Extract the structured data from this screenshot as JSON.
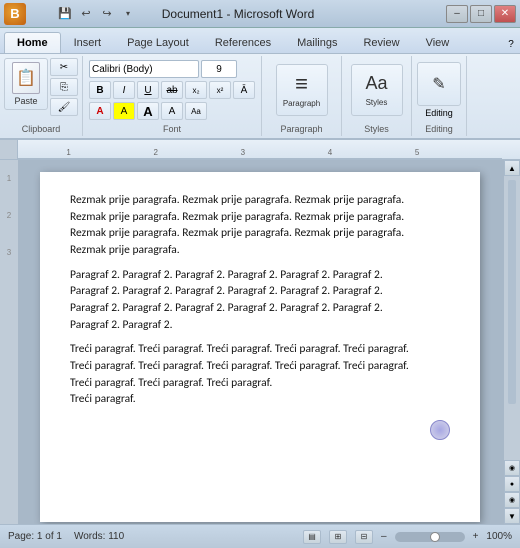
{
  "titlebar": {
    "title": "Document1 - Microsoft Word",
    "app_label": "W",
    "min_label": "–",
    "max_label": "□",
    "close_label": "✕"
  },
  "quickaccess": {
    "save_label": "💾",
    "undo_label": "↩",
    "redo_label": "↪",
    "dropdown_label": "▾"
  },
  "ribbon": {
    "tabs": [
      {
        "label": "Home",
        "active": true
      },
      {
        "label": "Insert"
      },
      {
        "label": "Page Layout"
      },
      {
        "label": "References"
      },
      {
        "label": "Mailings"
      },
      {
        "label": "Review"
      },
      {
        "label": "View"
      }
    ],
    "groups": {
      "clipboard": {
        "label": "Clipboard",
        "paste": "Paste",
        "cut": "Cut",
        "copy": "Copy",
        "format_painter": "Format Painter"
      },
      "font": {
        "label": "Font",
        "name": "Calibri (Body)",
        "size": "9",
        "bold": "B",
        "italic": "I",
        "underline": "U",
        "strikethrough": "ab",
        "subscript": "x₂",
        "superscript": "x²",
        "clear": "A",
        "font_color": "A",
        "highlight": "A",
        "font_size_grow": "A",
        "font_size_shrink": "A"
      },
      "paragraph": {
        "label": "Paragraph",
        "icon": "≡"
      },
      "styles": {
        "label": "Styles",
        "icon": "Aa"
      },
      "editing": {
        "label": "Editing",
        "icon": "✎"
      }
    }
  },
  "ruler": {
    "marks": [
      "1",
      "2",
      "3",
      "4"
    ]
  },
  "document": {
    "paragraphs": [
      {
        "id": "p1",
        "lines": [
          "Rezmak prije paragrafa. Rezmak prije paragrafa. Rezmak prije paragrafa.",
          "Rezmak prije paragrafa. Rezmak prije paragrafa. Rezmak prije paragrafa.",
          "Rezmak prije paragrafa. Rezmak prije paragrafa. Rezmak prije paragrafa.",
          "Rezmak prije paragrafa."
        ]
      },
      {
        "id": "p2",
        "lines": [
          "Paragraf 2. Paragraf 2. Paragraf 2. Paragraf 2. Paragraf 2. Paragraf 2.",
          "Paragraf 2. Paragraf 2. Paragraf 2. Paragraf 2. Paragraf 2. Paragraf 2.",
          "Paragraf 2. Paragraf 2. Paragraf 2. Paragraf 2. Paragraf 2. Paragraf 2.",
          "Paragraf 2. Paragraf 2."
        ]
      },
      {
        "id": "p3",
        "lines": [
          "Treći paragraf. Treći paragraf. Treći paragraf. Treći paragraf. Treći paragraf.",
          "Treći paragraf. Treći paragraf. Treći paragraf. Treći paragraf. Treći paragraf.",
          "Treći paragraf. Treći paragraf. Treći paragraf.",
          "Treći paragraf."
        ]
      }
    ]
  },
  "statusbar": {
    "page_info": "Page: 1 of 1",
    "words": "Words: 110",
    "zoom_level": "100%",
    "zoom_minus": "–",
    "zoom_plus": "+"
  }
}
